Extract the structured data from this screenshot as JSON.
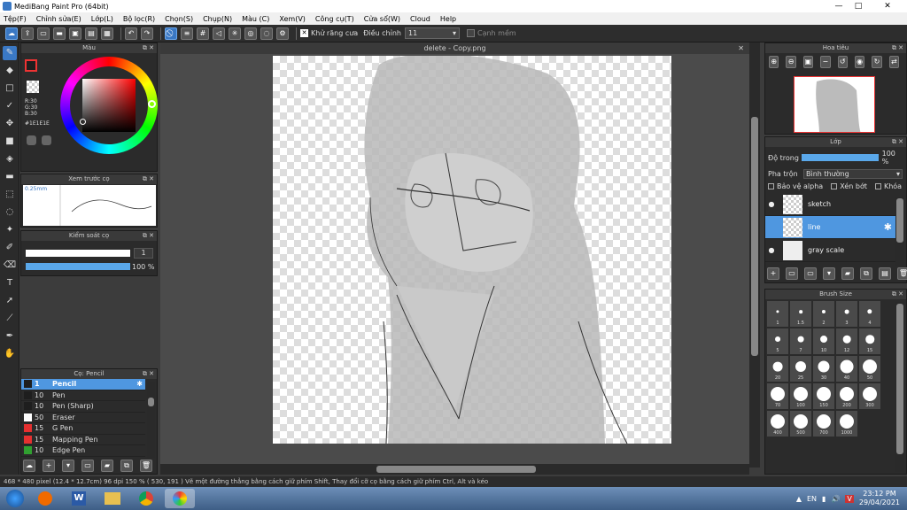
{
  "window": {
    "title": "MediBang Paint Pro (64bit)"
  },
  "menu": [
    "Tệp(F)",
    "Chỉnh sửa(E)",
    "Lớp(L)",
    "Bộ lọc(R)",
    "Chọn(S)",
    "Chụp(N)",
    "Màu (C)",
    "Xem(V)",
    "Công cụ(T)",
    "Cửa sổ(W)",
    "Cloud",
    "Help"
  ],
  "toolbar": {
    "antialias_label": "Khử răng cưa",
    "correction_label": "Điều chỉnh",
    "correction_value": "11",
    "smooth_label": "Cạnh mềm"
  },
  "color_panel": {
    "title": "Màu",
    "r": "R:30",
    "g": "G:30",
    "b": "B:30",
    "hex": "#1E1E1E"
  },
  "brush_preview": {
    "title": "Xem trước cọ",
    "size": "0.25mm"
  },
  "brush_control": {
    "title": "Kiểm soát cọ",
    "size_value": "1",
    "opacity": "100 %",
    "opacity_fraction": 1.0
  },
  "brush_list": {
    "title": "Cọ: Pencil",
    "items": [
      {
        "size": "1",
        "name": "Pencil",
        "color": "#1e1e1e",
        "selected": true
      },
      {
        "size": "10",
        "name": "Pen",
        "color": "#1e1e1e"
      },
      {
        "size": "10",
        "name": "Pen (Sharp)",
        "color": "#1e1e1e"
      },
      {
        "size": "50",
        "name": "Eraser",
        "color": "#ffffff"
      },
      {
        "size": "15",
        "name": "G Pen",
        "color": "#e63030"
      },
      {
        "size": "15",
        "name": "Mapping Pen",
        "color": "#e63030"
      },
      {
        "size": "10",
        "name": "Edge Pen",
        "color": "#30a030"
      }
    ]
  },
  "document": {
    "tab": "delete - Copy.png"
  },
  "navigator": {
    "title": "Hoa tiêu"
  },
  "layers": {
    "title": "Lớp",
    "opacity_label": "Độ trong",
    "opacity_value": "100 %",
    "opacity_fraction": 1.0,
    "blend_label": "Pha trộn",
    "blend_value": "Bình thường",
    "protect_alpha": "Bảo vệ alpha",
    "clipping": "Xén bớt",
    "lock": "Khóa",
    "items": [
      {
        "name": "sketch",
        "selected": false
      },
      {
        "name": "line",
        "selected": true
      },
      {
        "name": "gray scale",
        "selected": false
      }
    ]
  },
  "brush_size": {
    "title": "Brush Size",
    "sizes": [
      "1",
      "1.5",
      "2",
      "3",
      "4",
      "5",
      "7",
      "10",
      "12",
      "15",
      "20",
      "25",
      "30",
      "40",
      "50",
      "70",
      "100",
      "150",
      "200",
      "300",
      "400",
      "500",
      "700",
      "1000"
    ]
  },
  "status": {
    "text": "468 * 480 pixel   (12.4 * 12.7cm)   96 dpi   150 %   ( 530, 191 )   Vẽ một đường thẳng bằng cách giữ phím Shift, Thay đổi cỡ cọ bằng cách giữ phím Ctrl, Alt và kéo"
  },
  "taskbar": {
    "time": "23:12 PM",
    "date": "29/04/2021"
  },
  "colors": {
    "accent": "#4f97e0",
    "panel": "#2b2b2b",
    "canvas": "#4b4b4b"
  }
}
